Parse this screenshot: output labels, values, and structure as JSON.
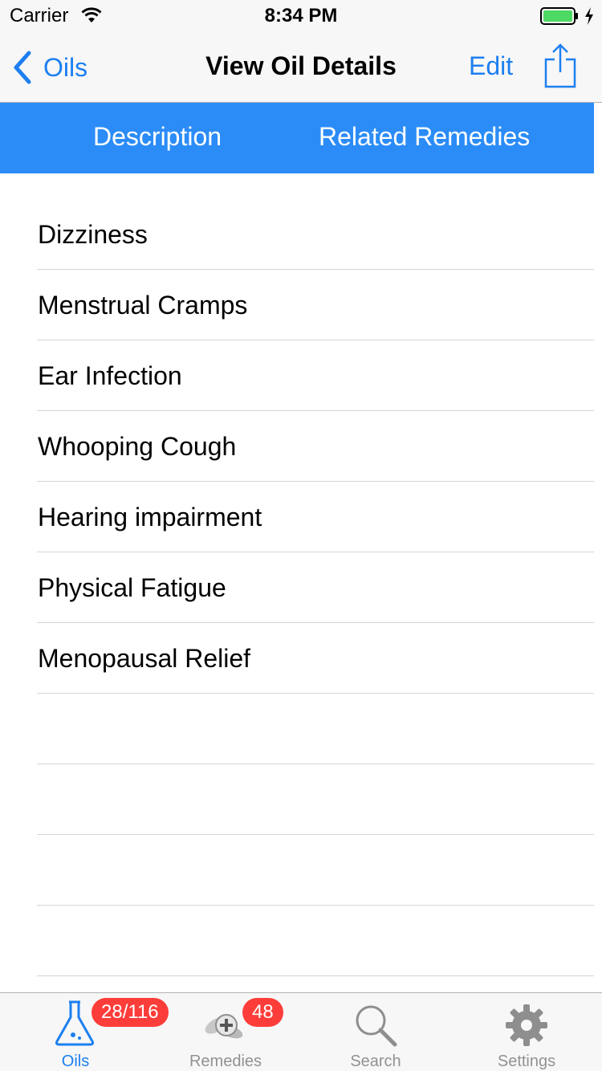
{
  "status_bar": {
    "carrier": "Carrier",
    "time": "8:34 PM",
    "battery_level": 1.0
  },
  "nav": {
    "back_label": "Oils",
    "title": "View Oil Details",
    "edit_label": "Edit"
  },
  "segments": {
    "description": "Description",
    "related_remedies": "Related Remedies"
  },
  "remedies": [
    "Dizziness",
    "Menstrual Cramps",
    "Ear Infection",
    "Whooping Cough",
    "Hearing impairment",
    "Physical Fatigue",
    "Menopausal Relief",
    "",
    "",
    "",
    ""
  ],
  "tabs": [
    {
      "label": "Oils",
      "badge": "28/116",
      "icon": "flask-icon",
      "active": true
    },
    {
      "label": "Remedies",
      "badge": "48",
      "icon": "remedies-icon",
      "active": false
    },
    {
      "label": "Search",
      "badge": "",
      "icon": "search-icon",
      "active": false
    },
    {
      "label": "Settings",
      "badge": "",
      "icon": "gear-icon",
      "active": false
    }
  ],
  "colors": {
    "accent": "#1d7ff0",
    "segment_bg": "#2b8cf7",
    "badge": "#fc3d39",
    "battery": "#4cd964"
  }
}
